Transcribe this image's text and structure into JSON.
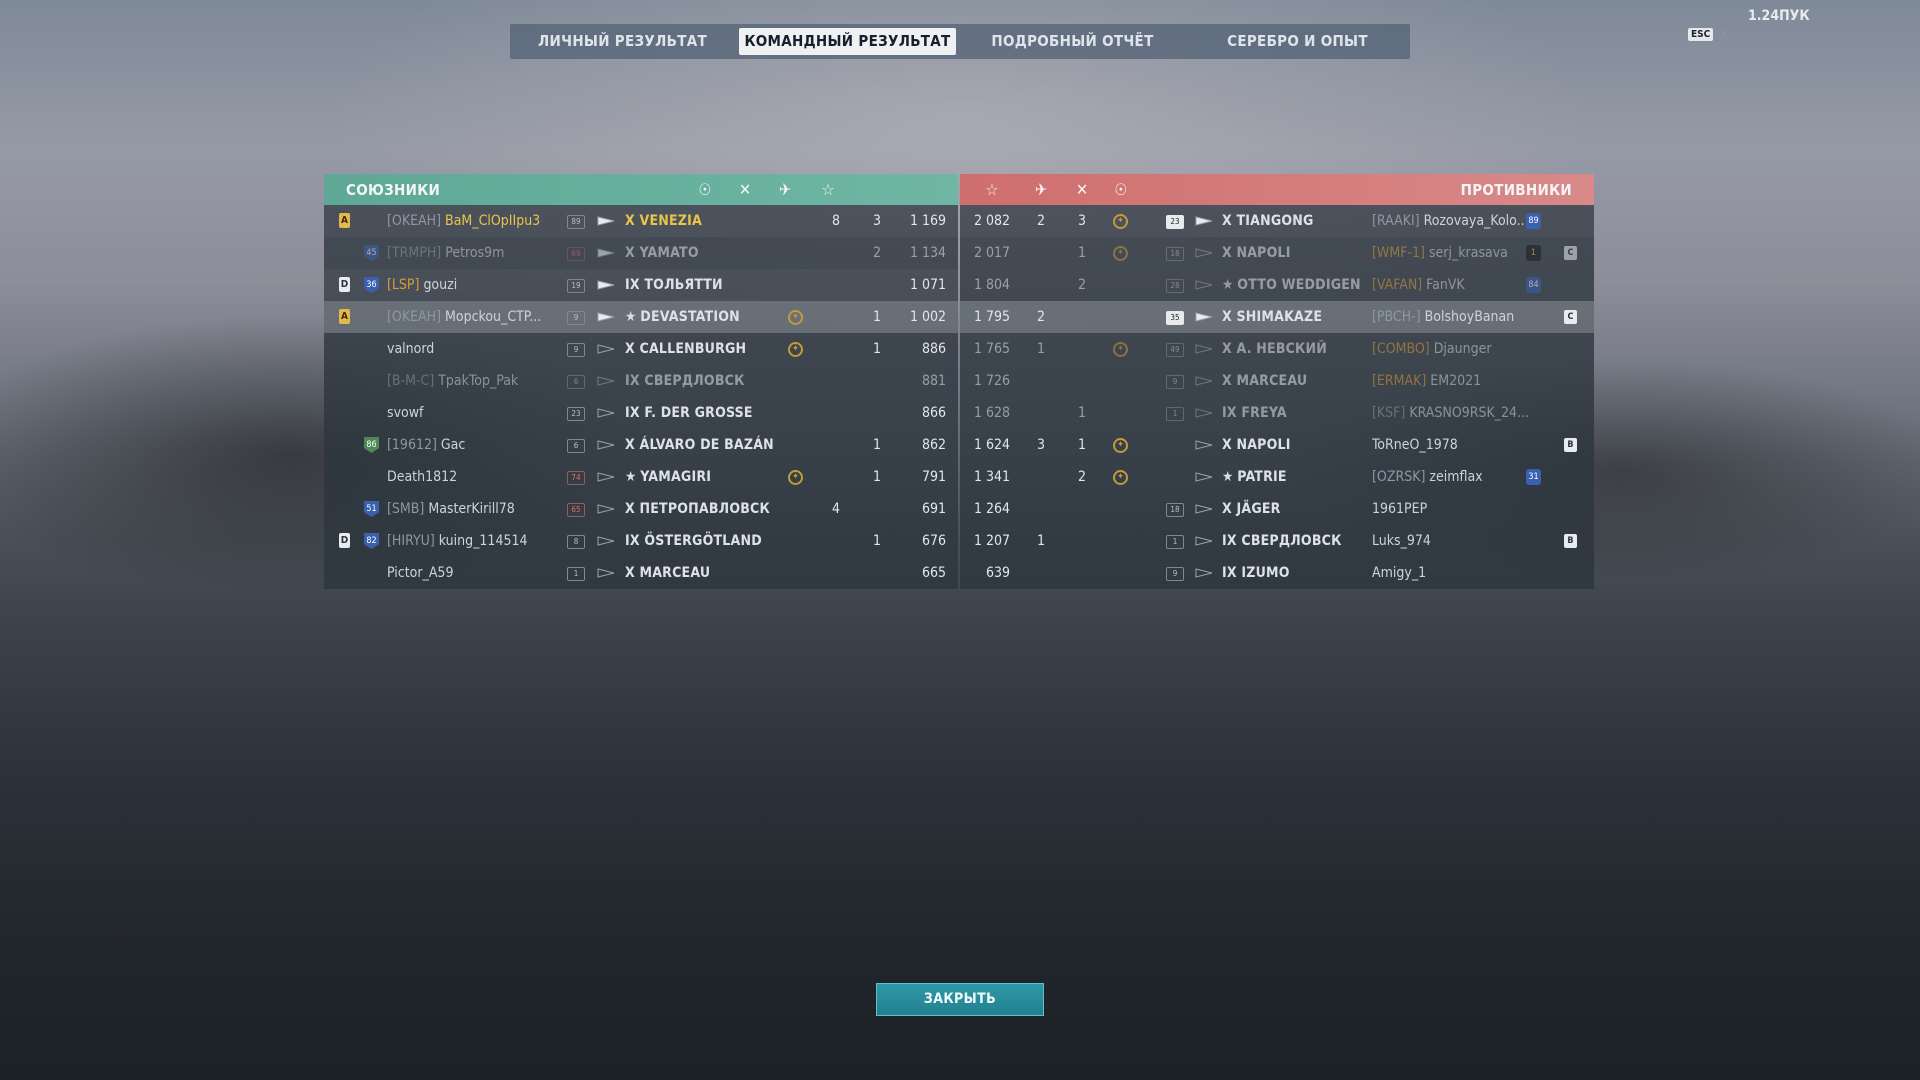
{
  "version": "1.24ПУК",
  "esc_label": "ESC",
  "tabs": [
    {
      "label": "ЛИЧНЫЙ РЕЗУЛЬТАТ",
      "active": false
    },
    {
      "label": "КОМАНДНЫЙ РЕЗУЛЬТАТ",
      "active": true
    },
    {
      "label": "ПОДРОБНЫЙ ОТЧЁТ",
      "active": false
    },
    {
      "label": "СЕРЕБРО И ОПЫТ",
      "active": false
    }
  ],
  "allies": {
    "title": "СОЮЗНИКИ",
    "rows": [
      {
        "rank": "A",
        "level": "",
        "clan": "[OKEAH]",
        "name": "BaM_ClOpIIpu3",
        "name_gold": true,
        "mm": "89",
        "ship": "X VENEZIA",
        "ship_gold": true,
        "star": false,
        "medal": false,
        "kills": "8",
        "planes": "3",
        "xp": "1 169",
        "style": "alt"
      },
      {
        "rank": "",
        "level": "45",
        "clan": "[TRMPH]",
        "name": "Petros9m",
        "mm": "69",
        "mm_red": true,
        "ship": "X YAMATO",
        "star": false,
        "medal": false,
        "kills": "",
        "planes": "2",
        "xp": "1 134",
        "style": "dead"
      },
      {
        "rank": "D",
        "level": "36",
        "clan": "[LSP]",
        "clan_orange": true,
        "name": "gouzi",
        "mm": "19",
        "ship": "IX ТОЛЬЯТТИ",
        "star": false,
        "medal": false,
        "kills": "",
        "planes": "",
        "xp": "1 071",
        "style": "alt"
      },
      {
        "rank": "A",
        "level": "",
        "clan": "[OKEAH]",
        "name": "Mopckou_CTP...",
        "mm": "9",
        "ship": "DEVASTATION",
        "star": true,
        "medal": true,
        "kills": "",
        "planes": "1",
        "xp": "1 002",
        "style": "me"
      },
      {
        "rank": "",
        "level": "",
        "clan": "",
        "name": "valnord",
        "mm": "9",
        "ship": "X CALLENBURGH",
        "star": false,
        "medal": true,
        "kills": "",
        "planes": "1",
        "xp": "886",
        "style": ""
      },
      {
        "rank": "",
        "level": "",
        "clan": "[B-M-C]",
        "name": "TpakTop_Pak",
        "mm": "6",
        "ship": "IX СВЕРДЛОВСК",
        "star": false,
        "medal": false,
        "kills": "",
        "planes": "",
        "xp": "881",
        "style": "dead"
      },
      {
        "rank": "",
        "level": "",
        "clan": "",
        "name": "svowf",
        "mm": "23",
        "ship": "IX F. DER GROSSE",
        "star": false,
        "medal": false,
        "kills": "",
        "planes": "",
        "xp": "866",
        "style": ""
      },
      {
        "rank": "",
        "level": "86",
        "level_green": true,
        "clan": "[19612]",
        "name": "Gac",
        "mm": "6",
        "ship": "X ÁLVARO DE BAZÁN",
        "star": false,
        "medal": false,
        "kills": "",
        "planes": "1",
        "xp": "862",
        "style": ""
      },
      {
        "rank": "",
        "level": "",
        "clan": "",
        "name": "Death1812",
        "mm": "74",
        "mm_red": true,
        "ship": "YAMAGIRI",
        "star": true,
        "medal": true,
        "kills": "",
        "planes": "1",
        "xp": "791",
        "style": ""
      },
      {
        "rank": "",
        "level": "51",
        "clan": "[SMB]",
        "name": "MasterKirill78",
        "mm": "65",
        "mm_red": true,
        "ship": "X ПЕТРОПАВЛОВСК",
        "star": false,
        "medal": false,
        "kills": "4",
        "planes": "",
        "xp": "691",
        "style": ""
      },
      {
        "rank": "D",
        "level": "82",
        "clan": "[HIRYU]",
        "name": "kuing_114514",
        "mm": "8",
        "ship": "IX ÖSTERGÖTLAND",
        "star": false,
        "medal": false,
        "kills": "",
        "planes": "1",
        "xp": "676",
        "style": ""
      },
      {
        "rank": "",
        "level": "",
        "clan": "",
        "name": "Pictor_A59",
        "mm": "1",
        "ship": "X MARCEAU",
        "star": false,
        "medal": false,
        "kills": "",
        "planes": "",
        "xp": "665",
        "style": ""
      }
    ]
  },
  "enemies": {
    "title": "ПРОТИВНИКИ",
    "rows": [
      {
        "xp": "2 082",
        "planes": "2",
        "kills": "3",
        "medal": true,
        "mm": "23",
        "mm_lit": true,
        "ship": "X TIANGONG",
        "star": false,
        "clan": "[RAAKI]",
        "name": "Rozovaya_Kolo...",
        "level": "89",
        "tag": "",
        "style": "alt"
      },
      {
        "xp": "2 017",
        "planes": "",
        "kills": "1",
        "medal": true,
        "mm": "18",
        "ship": "X NAPOLI",
        "star": false,
        "clan": "[WMF-1]",
        "clan_orange": true,
        "name": "serj_krasava",
        "level": "1",
        "level_dark": true,
        "tag": "C",
        "style": "dead"
      },
      {
        "xp": "1 804",
        "planes": "",
        "kills": "2",
        "medal": false,
        "mm": "28",
        "ship": "OTTO WEDDIGEN",
        "star": true,
        "clan": "[VAFAN]",
        "clan_orange": true,
        "name": "FanVK",
        "level": "84",
        "tag": "",
        "style": "dead"
      },
      {
        "xp": "1 795",
        "planes": "2",
        "kills": "",
        "medal": false,
        "mm": "35",
        "mm_lit": true,
        "ship": "X SHIMAKAZE",
        "star": false,
        "clan": "[PBCH-]",
        "name": "BolshoyBanan",
        "level": "",
        "tag": "C",
        "style": "me"
      },
      {
        "xp": "1 765",
        "planes": "1",
        "kills": "",
        "medal": true,
        "mm": "49",
        "ship": "X A. НЕВСКИЙ",
        "star": false,
        "clan": "[COMBO]",
        "clan_orange": true,
        "name": "Djaunger",
        "level": "",
        "tag": "",
        "style": "dead"
      },
      {
        "xp": "1 726",
        "planes": "",
        "kills": "",
        "medal": false,
        "mm": "9",
        "ship": "X MARCEAU",
        "star": false,
        "clan": "[ERMAK]",
        "clan_orange": true,
        "name": "EM2021",
        "level": "",
        "tag": "",
        "style": "dead"
      },
      {
        "xp": "1 628",
        "planes": "",
        "kills": "1",
        "medal": false,
        "mm": "1",
        "ship": "IX FREYA",
        "star": false,
        "clan": "[KSF]",
        "name": "KRASNO9RSK_24...",
        "level": "",
        "tag": "",
        "style": "dead"
      },
      {
        "xp": "1 624",
        "planes": "3",
        "kills": "1",
        "medal": true,
        "mm": "",
        "ship": "X NAPOLI",
        "star": false,
        "clan": "",
        "name": "ToRneO_1978",
        "level": "",
        "tag": "B",
        "style": ""
      },
      {
        "xp": "1 341",
        "planes": "",
        "kills": "2",
        "medal": true,
        "mm": "",
        "ship": "PATRIE",
        "star": true,
        "clan": "[OZRSK]",
        "name": "zeimflax",
        "level": "31",
        "tag": "",
        "style": ""
      },
      {
        "xp": "1 264",
        "planes": "",
        "kills": "",
        "medal": false,
        "mm": "18",
        "ship": "X JÄGER",
        "star": false,
        "clan": "",
        "name": "1961PEP",
        "level": "",
        "tag": "",
        "style": ""
      },
      {
        "xp": "1 207",
        "planes": "1",
        "kills": "",
        "medal": false,
        "mm": "1",
        "ship": "IX СВЕРДЛОВСК",
        "star": false,
        "clan": "",
        "name": "Luks_974",
        "level": "",
        "tag": "B",
        "style": ""
      },
      {
        "xp": "639",
        "planes": "",
        "kills": "",
        "medal": false,
        "mm": "9",
        "ship": "IX IZUMO",
        "star": false,
        "clan": "",
        "name": "Amigy_1",
        "level": "",
        "tag": "",
        "style": ""
      }
    ]
  },
  "icons": {
    "header_ally": [
      "laurel-icon",
      "swords-icon",
      "plane-icon",
      "star-icon"
    ],
    "header_enemy": [
      "star-icon",
      "plane-icon",
      "swords-icon",
      "laurel-icon"
    ]
  },
  "colors": {
    "ally": "#6fb7a3",
    "enemy": "#d98989",
    "gold": "#e8c54a",
    "button": "#2a8a98"
  },
  "close_label": "ЗАКРЫТЬ"
}
